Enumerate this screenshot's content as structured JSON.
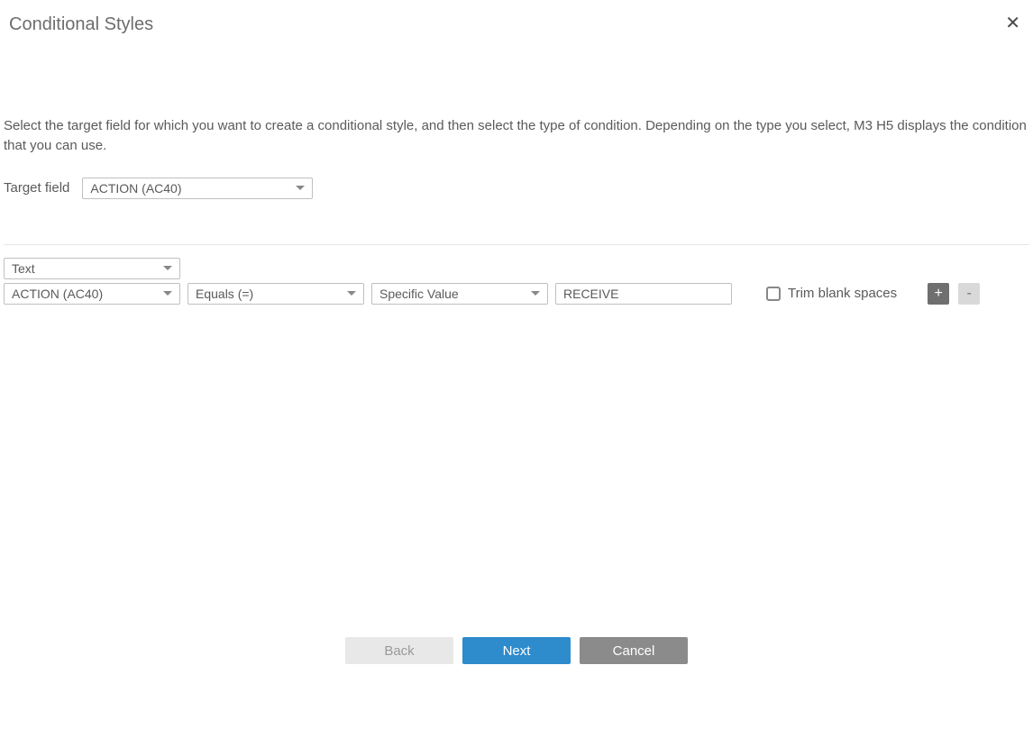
{
  "dialog": {
    "title": "Conditional Styles",
    "intro": "Select the target field for which you want to create a conditional style, and then select the type of condition. Depending on the type you select, M3 H5 displays the condition that you can use."
  },
  "target": {
    "label": "Target field",
    "value": "ACTION (AC40)"
  },
  "condition": {
    "type": "Text",
    "field": "ACTION (AC40)",
    "operator": "Equals (=)",
    "value_type": "Specific Value",
    "value": "RECEIVE",
    "trim_label": "Trim blank spaces",
    "trim_checked": false
  },
  "buttons": {
    "add": "+",
    "remove": "-",
    "back": "Back",
    "next": "Next",
    "cancel": "Cancel"
  }
}
